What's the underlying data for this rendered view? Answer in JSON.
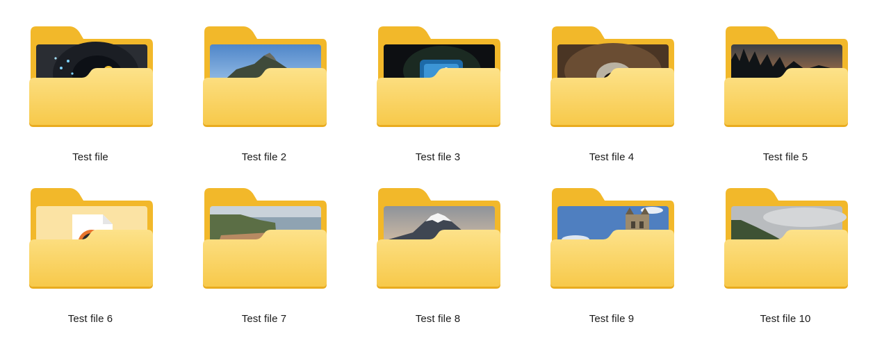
{
  "folders": [
    {
      "label": "Test file",
      "thumbnail": "tunnel-night-photo"
    },
    {
      "label": "Test file 2",
      "thumbnail": "coastal-island-photo"
    },
    {
      "label": "Test file 3",
      "thumbnail": "cave-blue-pool-photo"
    },
    {
      "label": "Test file 4",
      "thumbnail": "rock-cave-photo"
    },
    {
      "label": "Test file 5",
      "thumbnail": "forest-sunset-photo"
    },
    {
      "label": "Test file 6",
      "thumbnail": "video-file-icon"
    },
    {
      "label": "Test file 7",
      "thumbnail": "sea-cliff-photo"
    },
    {
      "label": "Test file 8",
      "thumbnail": "mount-fuji-photo"
    },
    {
      "label": "Test file 9",
      "thumbnail": "tower-bridge-photo"
    },
    {
      "label": "Test file 10",
      "thumbnail": "cloudy-hills-photo"
    }
  ],
  "colors": {
    "folder_back": "#f2b82a",
    "folder_front_top": "#fde28a",
    "folder_front_bottom": "#f7c94a",
    "folder_front_edge": "#e9ac1f"
  }
}
